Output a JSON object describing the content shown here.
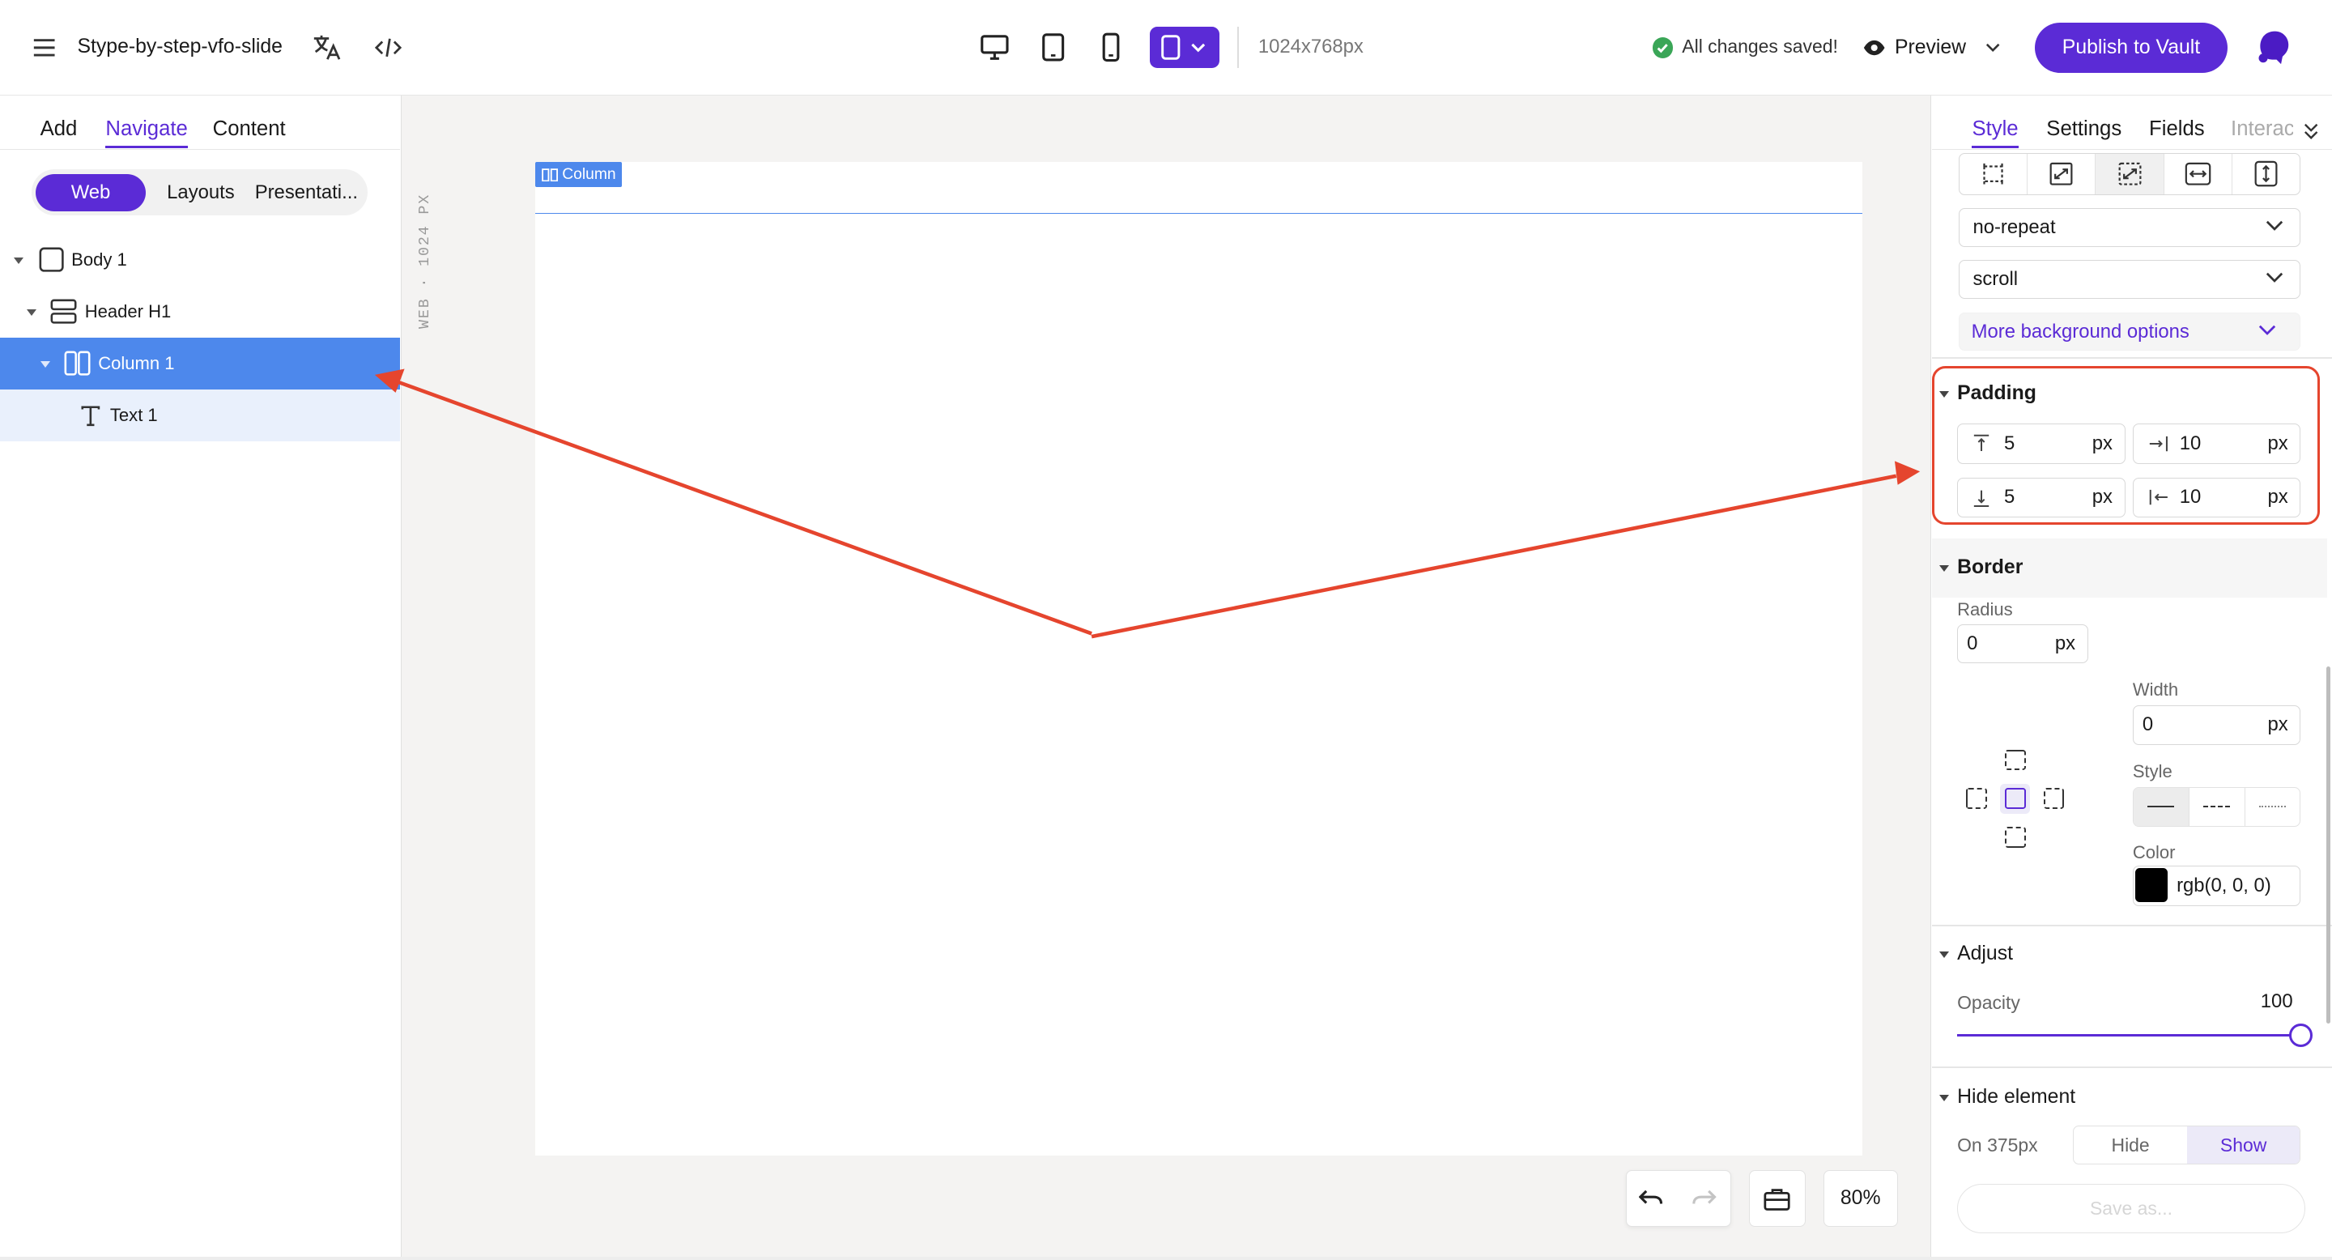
{
  "header": {
    "title": "Stype-by-step-vfo-slide",
    "resolution": "1024x768px",
    "save_status": "All changes saved!",
    "preview_label": "Preview",
    "publish_label": "Publish to Vault"
  },
  "left_panel": {
    "tabs": [
      "Add",
      "Navigate",
      "Content"
    ],
    "active_tab": "Navigate",
    "modes": [
      "Web",
      "Layouts",
      "Presentati..."
    ],
    "active_mode": "Web",
    "tree": [
      {
        "label": "Body 1",
        "icon": "body-icon"
      },
      {
        "label": "Header H1",
        "icon": "header-icon"
      },
      {
        "label": "Column 1",
        "icon": "column-icon",
        "selected": true
      },
      {
        "label": "Text 1",
        "icon": "text-icon"
      }
    ]
  },
  "canvas": {
    "ruler_label": "WEB · 1024 PX",
    "selection_tag": "Column",
    "zoom": "80%"
  },
  "right_panel": {
    "tabs": [
      "Style",
      "Settings",
      "Fields",
      "Interac"
    ],
    "active_tab": "Style",
    "background": {
      "repeat": "no-repeat",
      "attachment": "scroll",
      "more_label": "More background options"
    },
    "padding": {
      "title": "Padding",
      "top": "5",
      "right": "10",
      "bottom": "5",
      "left": "10",
      "unit": "px"
    },
    "border": {
      "title": "Border",
      "radius_label": "Radius",
      "radius": "0",
      "width_label": "Width",
      "width": "0",
      "style_label": "Style",
      "color_label": "Color",
      "color": "rgb(0, 0, 0)",
      "unit": "px"
    },
    "adjust": {
      "title": "Adjust",
      "opacity_label": "Opacity",
      "opacity": "100"
    },
    "hide": {
      "title": "Hide element",
      "on_label": "On 375px",
      "hide_label": "Hide",
      "show_label": "Show",
      "save_label": "Save as..."
    }
  },
  "colors": {
    "accent": "#5b2bd6",
    "selection": "#4d88ec",
    "annotation": "#e5452e"
  }
}
